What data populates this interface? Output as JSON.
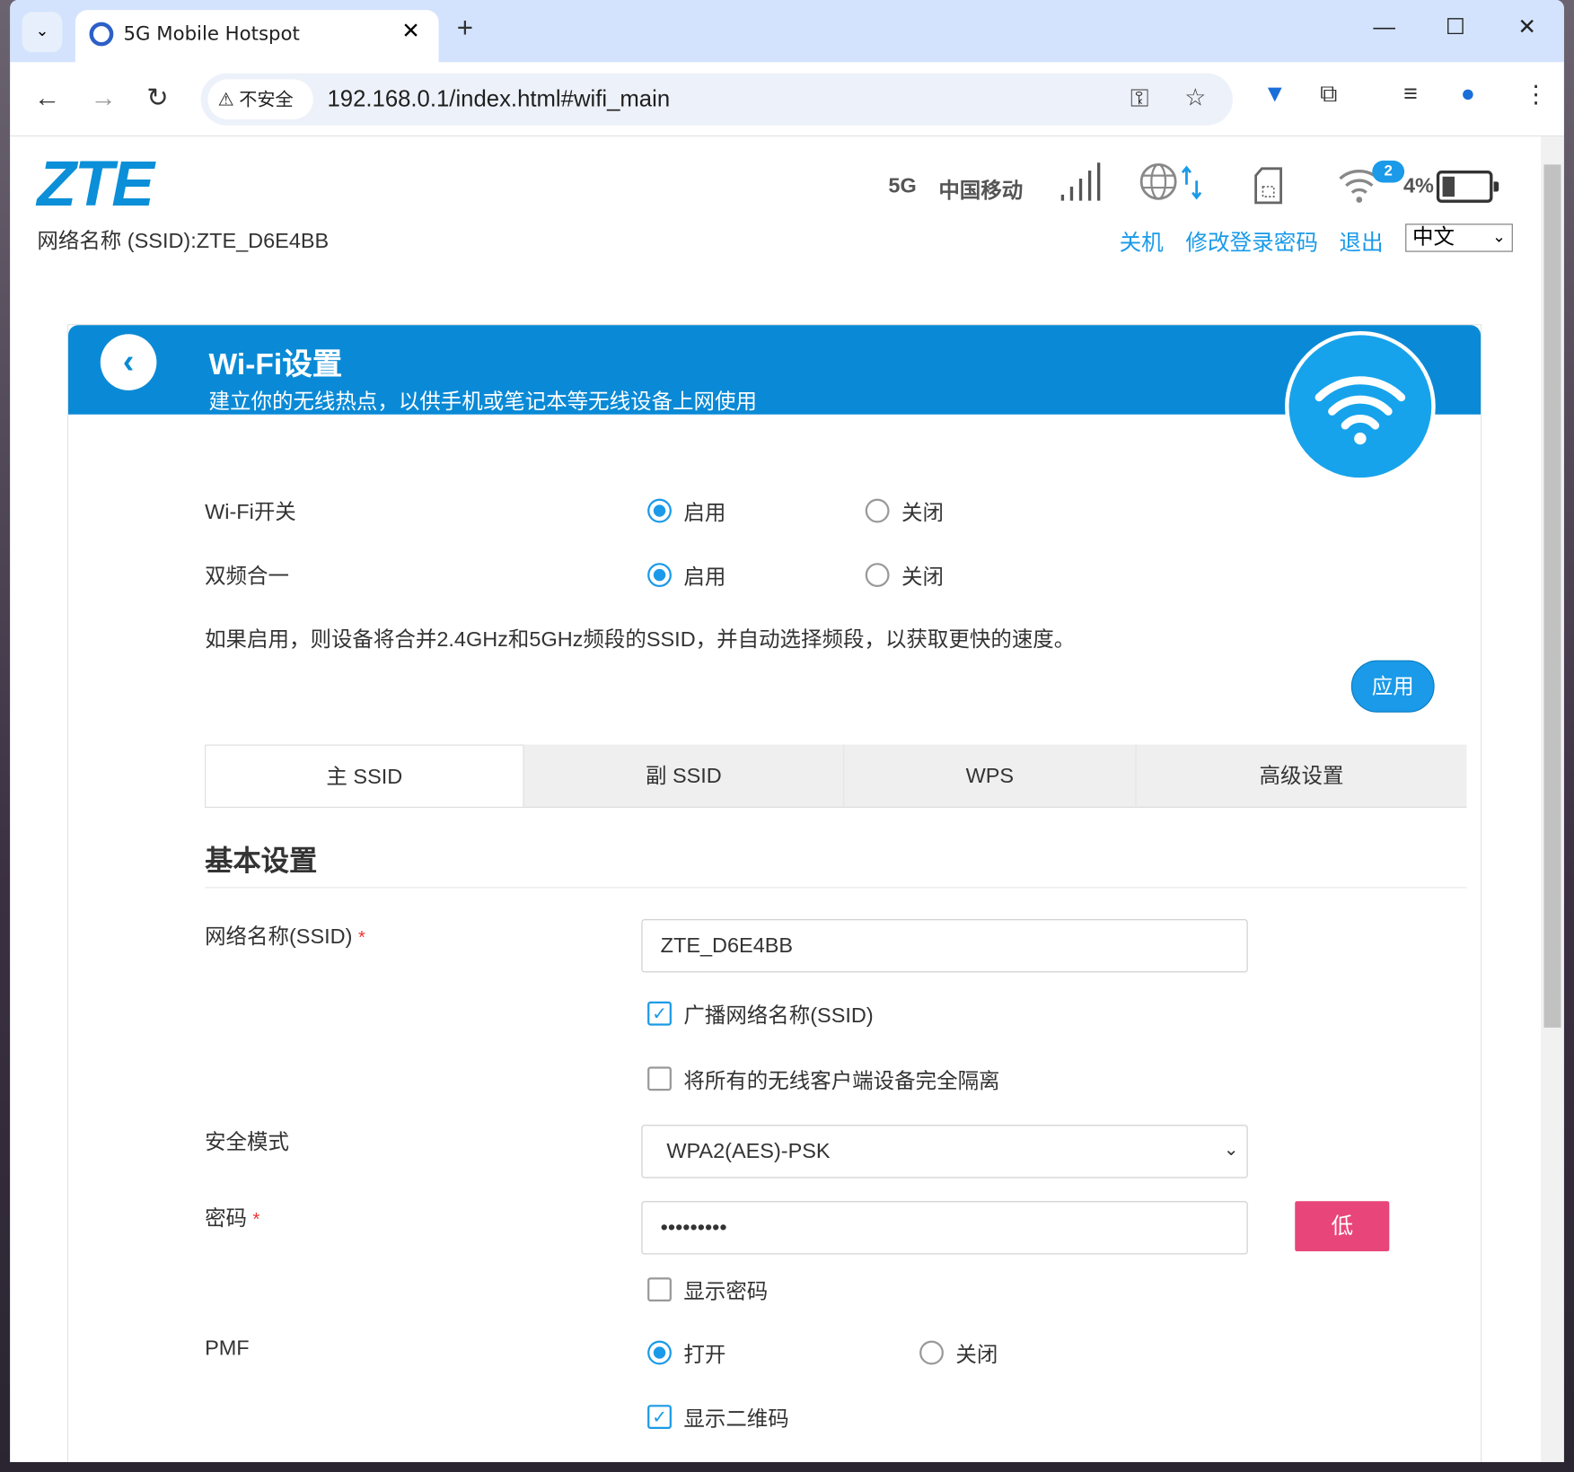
{
  "browser": {
    "tab_title": "5G Mobile Hotspot",
    "security_label": "不安全",
    "url": "192.168.0.1/index.html#wifi_main"
  },
  "header": {
    "logo": "ZTE",
    "ssid_display": "网络名称 (SSID):ZTE_D6E4BB",
    "network_type": "5G",
    "carrier": "中国移动",
    "connected_devices": "2",
    "battery_percent": "4%",
    "battery_level": 0.04,
    "links": {
      "shutdown": "关机",
      "change_password": "修改登录密码",
      "logout": "退出"
    },
    "language": "中文"
  },
  "panel": {
    "title": "Wi-Fi设置",
    "subtitle": "建立你的无线热点，以供手机或笔记本等无线设备上网使用"
  },
  "wifi_switch": {
    "label": "Wi-Fi开关",
    "on": "启用",
    "off": "关闭",
    "selected": "启用"
  },
  "dual_band": {
    "label": "双频合一",
    "on": "启用",
    "off": "关闭",
    "selected": "启用"
  },
  "dual_band_note": "如果启用，则设备将合并2.4GHz和5GHz频段的SSID，并自动选择频段，以获取更快的速度。",
  "apply_label": "应用",
  "tabs": [
    {
      "label": "主 SSID",
      "active": true
    },
    {
      "label": "副 SSID"
    },
    {
      "label": "WPS"
    },
    {
      "label": "高级设置"
    }
  ],
  "basic": {
    "heading": "基本设置",
    "ssid_label": "网络名称(SSID)",
    "ssid_value": "ZTE_D6E4BB",
    "broadcast_label": "广播网络名称(SSID)",
    "broadcast_checked": true,
    "isolate_label": "将所有的无线客户端设备完全隔离",
    "isolate_checked": false,
    "security_label": "安全模式",
    "security_value": "WPA2(AES)-PSK",
    "password_label": "密码",
    "password_value": "•••••••••",
    "strength": "低",
    "strength_color": "#e8467a",
    "show_password_label": "显示密码",
    "show_password_checked": false,
    "pmf_label": "PMF",
    "pmf_on": "打开",
    "pmf_off": "关闭",
    "pmf_selected": "打开",
    "qr_label": "显示二维码",
    "qr_checked": true
  },
  "required_mark": "*",
  "colors": {
    "accent": "#1a9ae8",
    "header_blue": "#0a8ad6"
  }
}
